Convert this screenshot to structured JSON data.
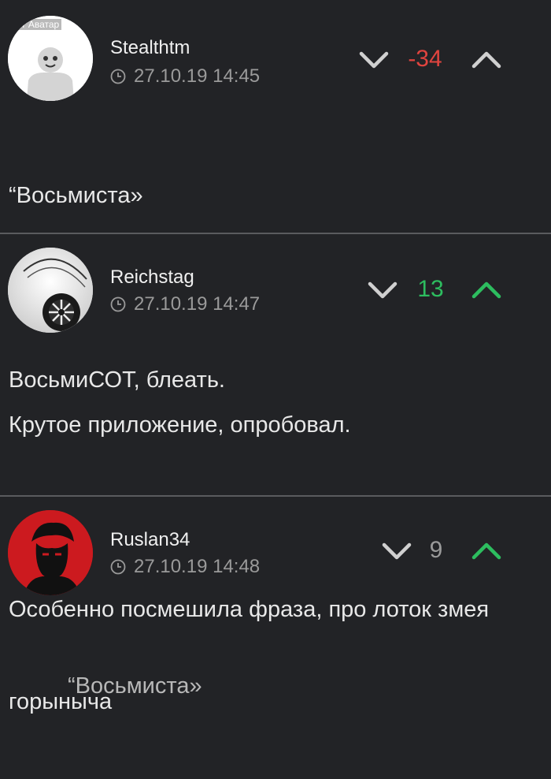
{
  "colors": {
    "background": "#222326",
    "negative": "#e0443f",
    "positive": "#2dbd5f",
    "neutral": "#9a9a9a",
    "divider": "#5a5b5e"
  },
  "comments": [
    {
      "author": "Stealthtm",
      "date": "27.10.19 14:45",
      "score": "-34",
      "avatar_caption": "т Аватар",
      "text_lines": [
        "“Восьмиста»",
        "",
        "ВосьмиСОТ, блеать."
      ]
    },
    {
      "author": "Reichstag",
      "date": "27.10.19 14:47",
      "score": "13",
      "text_lines": [
        "Крутое приложение, опробовал.",
        "",
        "Особенно посмешила фраза, про лоток змея",
        "горыныча"
      ]
    },
    {
      "author": "Ruslan34",
      "date": "27.10.19 14:48",
      "score": "9",
      "text_lines": [
        "“Восьмиста»"
      ]
    }
  ],
  "icons": {
    "vote_down": "chevron-down-icon",
    "vote_up": "chevron-up-icon",
    "date": "clock-icon"
  }
}
